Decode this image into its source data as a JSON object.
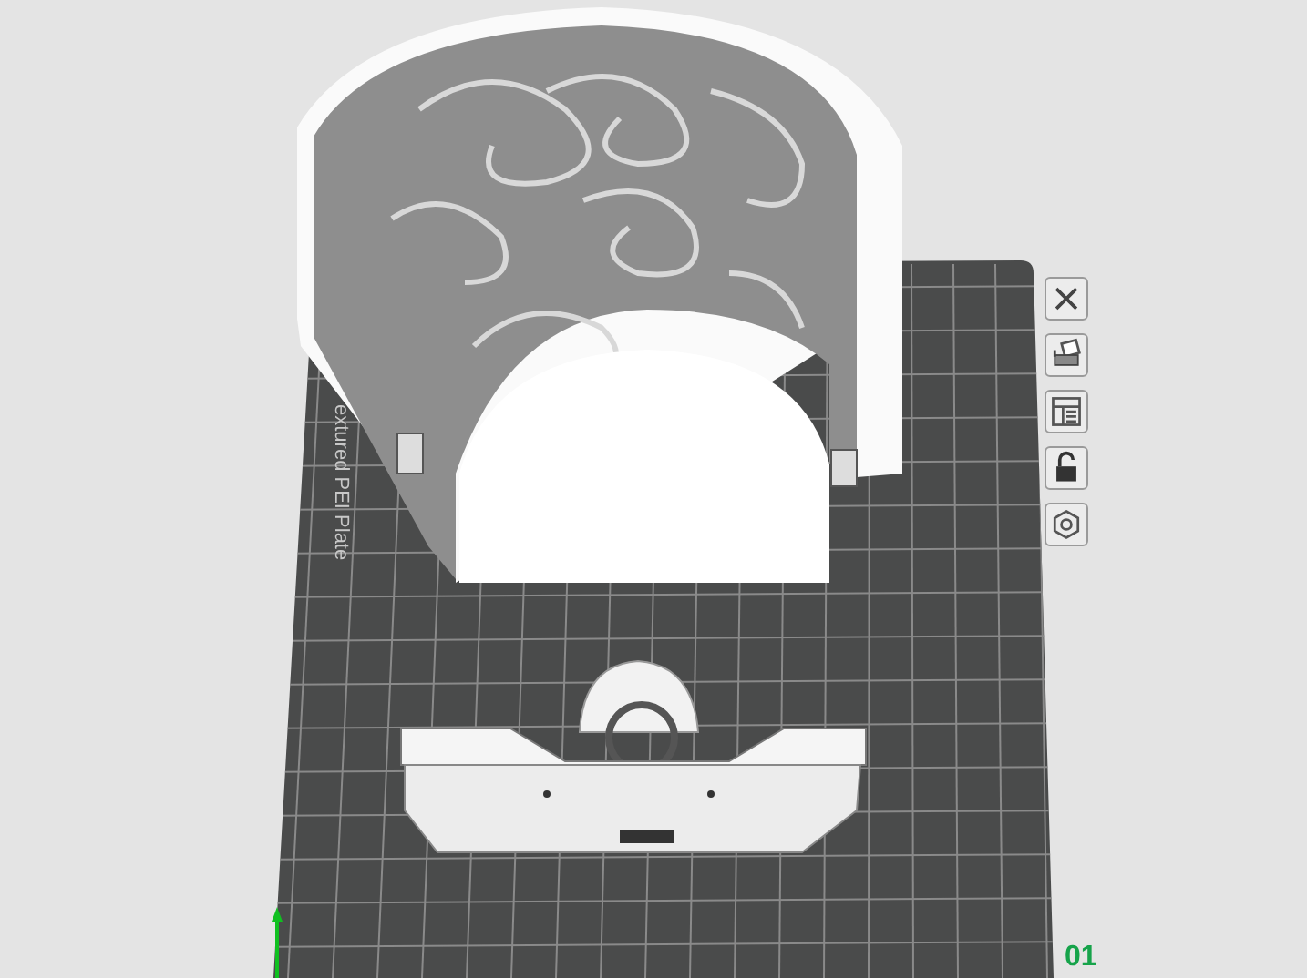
{
  "plate": {
    "label": "extured PEI Plate",
    "number": "01"
  },
  "toolbar": [
    {
      "kind": "close"
    },
    {
      "kind": "arrange"
    },
    {
      "kind": "layout"
    },
    {
      "kind": "lock"
    },
    {
      "kind": "settings"
    }
  ]
}
